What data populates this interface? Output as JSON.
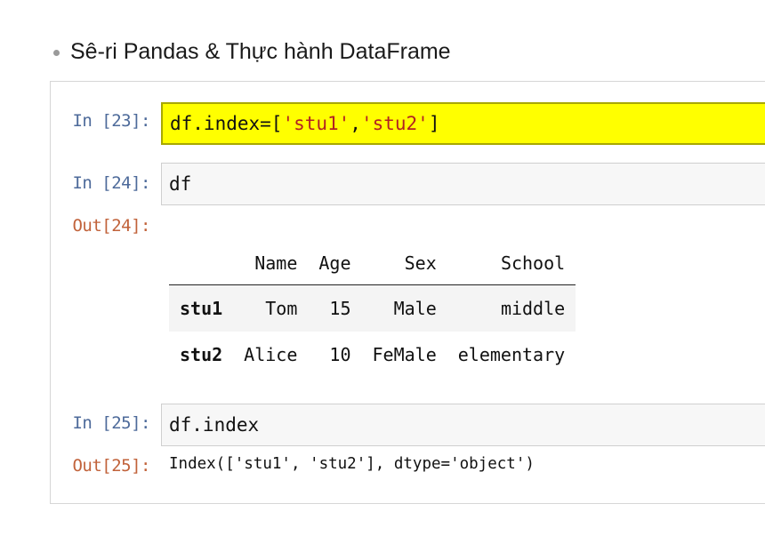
{
  "slide": {
    "title": "Sê-ri Pandas & Thực hành DataFrame"
  },
  "cells": [
    {
      "in_prompt": "In [23]:",
      "code": {
        "a": "df.index=[",
        "s1": "'stu1'",
        "comma": ",",
        "s2": "'stu2'",
        "b": "]"
      }
    },
    {
      "in_prompt": "In [24]:",
      "code": "df",
      "out_prompt": "Out[24]:"
    },
    {
      "in_prompt": "In [25]:",
      "code": "df.index",
      "out_prompt": "Out[25]:",
      "output": "Index(['stu1', 'stu2'], dtype='object')"
    }
  ],
  "dataframe": {
    "columns": [
      "Name",
      "Age",
      "Sex",
      "School"
    ],
    "rows": [
      {
        "index": "stu1",
        "values": [
          "Tom",
          "15",
          "Male",
          "middle"
        ]
      },
      {
        "index": "stu2",
        "values": [
          "Alice",
          "10",
          "FeMale",
          "elementary"
        ]
      }
    ]
  },
  "colors": {
    "selected_cell": "#ffff00",
    "in_prompt": "#4d6a9a",
    "out_prompt": "#c1623a",
    "string_literal": "#b22222"
  }
}
